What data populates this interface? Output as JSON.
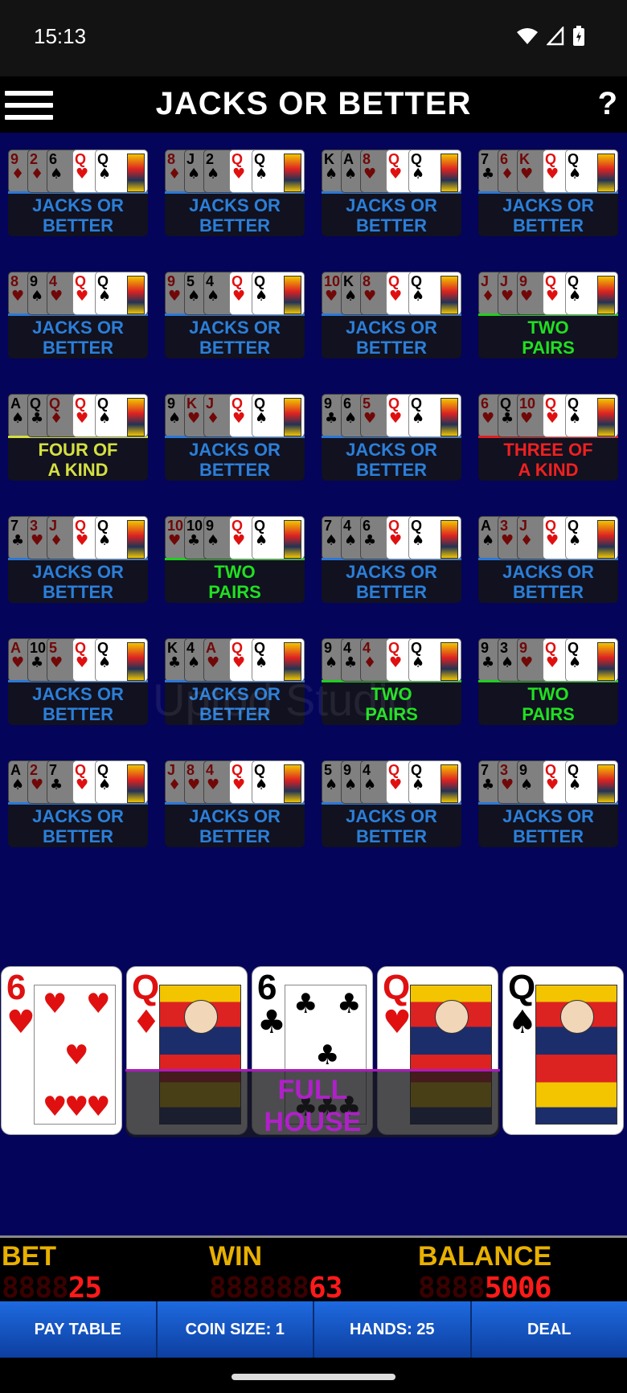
{
  "status": {
    "time": "15:13"
  },
  "header": {
    "title": "JACKS OR BETTER",
    "help": "?"
  },
  "watermark": "Uptod Studio",
  "hands": [
    {
      "label1": "JACKS OR",
      "label2": "BETTER",
      "type": "jacks",
      "cards": [
        [
          "9",
          "♦",
          "red"
        ],
        [
          "2",
          "♦",
          "red"
        ],
        [
          "6",
          "♠",
          "black"
        ]
      ]
    },
    {
      "label1": "JACKS OR",
      "label2": "BETTER",
      "type": "jacks",
      "cards": [
        [
          "8",
          "♦",
          "red"
        ],
        [
          "J",
          "♠",
          "black"
        ],
        [
          "2",
          "♠",
          "black"
        ]
      ]
    },
    {
      "label1": "JACKS OR",
      "label2": "BETTER",
      "type": "jacks",
      "cards": [
        [
          "K",
          "♠",
          "black"
        ],
        [
          "A",
          "♠",
          "black"
        ],
        [
          "8",
          "♥",
          "red"
        ]
      ]
    },
    {
      "label1": "JACKS OR",
      "label2": "BETTER",
      "type": "jacks",
      "cards": [
        [
          "7",
          "♣",
          "black"
        ],
        [
          "6",
          "♦",
          "red"
        ],
        [
          "K",
          "♥",
          "red"
        ]
      ]
    },
    {
      "label1": "JACKS OR",
      "label2": "BETTER",
      "type": "jacks",
      "cards": [
        [
          "8",
          "♥",
          "red"
        ],
        [
          "9",
          "♠",
          "black"
        ],
        [
          "4",
          "♥",
          "red"
        ]
      ]
    },
    {
      "label1": "JACKS OR",
      "label2": "BETTER",
      "type": "jacks",
      "cards": [
        [
          "9",
          "♥",
          "red"
        ],
        [
          "5",
          "♠",
          "black"
        ],
        [
          "4",
          "♠",
          "black"
        ]
      ]
    },
    {
      "label1": "JACKS OR",
      "label2": "BETTER",
      "type": "jacks",
      "cards": [
        [
          "10",
          "♥",
          "red"
        ],
        [
          "K",
          "♠",
          "black"
        ],
        [
          "8",
          "♥",
          "red"
        ]
      ]
    },
    {
      "label1": "TWO",
      "label2": "PAIRS",
      "type": "two",
      "cards": [
        [
          "J",
          "♦",
          "red"
        ],
        [
          "J",
          "♥",
          "red"
        ],
        [
          "9",
          "♥",
          "red"
        ]
      ]
    },
    {
      "label1": "FOUR OF",
      "label2": "A KIND",
      "type": "four",
      "cards": [
        [
          "A",
          "♠",
          "black"
        ],
        [
          "Q",
          "♣",
          "black"
        ],
        [
          "Q",
          "♦",
          "red"
        ]
      ]
    },
    {
      "label1": "JACKS OR",
      "label2": "BETTER",
      "type": "jacks",
      "cards": [
        [
          "9",
          "♠",
          "black"
        ],
        [
          "K",
          "♥",
          "red"
        ],
        [
          "J",
          "♦",
          "red"
        ]
      ]
    },
    {
      "label1": "JACKS OR",
      "label2": "BETTER",
      "type": "jacks",
      "cards": [
        [
          "9",
          "♣",
          "black"
        ],
        [
          "6",
          "♠",
          "black"
        ],
        [
          "5",
          "♥",
          "red"
        ]
      ]
    },
    {
      "label1": "THREE OF",
      "label2": "A KIND",
      "type": "three",
      "cards": [
        [
          "6",
          "♥",
          "red"
        ],
        [
          "Q",
          "♣",
          "black"
        ],
        [
          "10",
          "♥",
          "red"
        ]
      ]
    },
    {
      "label1": "JACKS OR",
      "label2": "BETTER",
      "type": "jacks",
      "cards": [
        [
          "7",
          "♣",
          "black"
        ],
        [
          "3",
          "♥",
          "red"
        ],
        [
          "J",
          "♦",
          "red"
        ]
      ]
    },
    {
      "label1": "TWO",
      "label2": "PAIRS",
      "type": "two",
      "cards": [
        [
          "10",
          "♥",
          "red"
        ],
        [
          "10",
          "♣",
          "black"
        ],
        [
          "9",
          "♠",
          "black"
        ]
      ]
    },
    {
      "label1": "JACKS OR",
      "label2": "BETTER",
      "type": "jacks",
      "cards": [
        [
          "7",
          "♠",
          "black"
        ],
        [
          "4",
          "♠",
          "black"
        ],
        [
          "6",
          "♣",
          "black"
        ]
      ]
    },
    {
      "label1": "JACKS OR",
      "label2": "BETTER",
      "type": "jacks",
      "cards": [
        [
          "A",
          "♠",
          "black"
        ],
        [
          "3",
          "♥",
          "red"
        ],
        [
          "J",
          "♦",
          "red"
        ]
      ]
    },
    {
      "label1": "JACKS OR",
      "label2": "BETTER",
      "type": "jacks",
      "cards": [
        [
          "A",
          "♥",
          "red"
        ],
        [
          "10",
          "♣",
          "black"
        ],
        [
          "5",
          "♥",
          "red"
        ]
      ]
    },
    {
      "label1": "JACKS OR",
      "label2": "BETTER",
      "type": "jacks",
      "cards": [
        [
          "K",
          "♣",
          "black"
        ],
        [
          "4",
          "♠",
          "black"
        ],
        [
          "A",
          "♥",
          "red"
        ]
      ]
    },
    {
      "label1": "TWO",
      "label2": "PAIRS",
      "type": "two",
      "cards": [
        [
          "9",
          "♠",
          "black"
        ],
        [
          "4",
          "♣",
          "black"
        ],
        [
          "4",
          "♦",
          "red"
        ]
      ]
    },
    {
      "label1": "TWO",
      "label2": "PAIRS",
      "type": "two",
      "cards": [
        [
          "9",
          "♣",
          "black"
        ],
        [
          "3",
          "♠",
          "black"
        ],
        [
          "9",
          "♥",
          "red"
        ]
      ]
    },
    {
      "label1": "JACKS OR",
      "label2": "BETTER",
      "type": "jacks",
      "cards": [
        [
          "A",
          "♠",
          "black"
        ],
        [
          "2",
          "♥",
          "red"
        ],
        [
          "7",
          "♣",
          "black"
        ]
      ]
    },
    {
      "label1": "JACKS OR",
      "label2": "BETTER",
      "type": "jacks",
      "cards": [
        [
          "J",
          "♦",
          "red"
        ],
        [
          "8",
          "♥",
          "red"
        ],
        [
          "4",
          "♥",
          "red"
        ]
      ]
    },
    {
      "label1": "JACKS OR",
      "label2": "BETTER",
      "type": "jacks",
      "cards": [
        [
          "5",
          "♠",
          "black"
        ],
        [
          "9",
          "♠",
          "black"
        ],
        [
          "4",
          "♠",
          "black"
        ]
      ]
    },
    {
      "label1": "JACKS OR",
      "label2": "BETTER",
      "type": "jacks",
      "cards": [
        [
          "7",
          "♣",
          "black"
        ],
        [
          "3",
          "♥",
          "red"
        ],
        [
          "9",
          "♠",
          "black"
        ]
      ]
    }
  ],
  "held_mini": [
    [
      "Q",
      "♥",
      "red"
    ],
    [
      "Q",
      "♠",
      "black"
    ]
  ],
  "main_hand": {
    "result1": "FULL",
    "result2": "HOUSE",
    "cards": [
      {
        "rank": "6",
        "suit": "♥",
        "color": "red",
        "kind": "pip"
      },
      {
        "rank": "Q",
        "suit": "♦",
        "color": "red",
        "kind": "court"
      },
      {
        "rank": "6",
        "suit": "♣",
        "color": "black",
        "kind": "pip"
      },
      {
        "rank": "Q",
        "suit": "♥",
        "color": "red",
        "kind": "court"
      },
      {
        "rank": "Q",
        "suit": "♠",
        "color": "black",
        "kind": "court"
      }
    ]
  },
  "score": {
    "bet_label": "BET",
    "bet_ghost": "8888",
    "bet_value": "25",
    "win_label": "WIN",
    "win_ghost": "888888",
    "win_value": "63",
    "balance_label": "BALANCE",
    "balance_ghost": "8888",
    "balance_value": "5006"
  },
  "buttons": {
    "pay_table": "PAY TABLE",
    "coin_size": "COIN SIZE: 1",
    "hands": "HANDS: 25",
    "deal": "DEAL"
  }
}
